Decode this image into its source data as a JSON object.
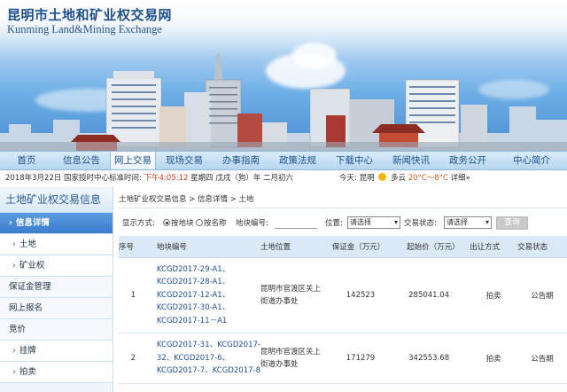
{
  "site": {
    "title_cn": "昆明市土地和矿业权交易网",
    "title_en": "Kunming Land&Mining Exchange"
  },
  "nav": [
    {
      "label": "首页"
    },
    {
      "label": "信息公告"
    },
    {
      "label": "网上交易"
    },
    {
      "label": "现场交易"
    },
    {
      "label": "办事指南"
    },
    {
      "label": "政策法规"
    },
    {
      "label": "下载中心"
    },
    {
      "label": "新闻快讯"
    },
    {
      "label": "政务公开"
    },
    {
      "label": "中心简介"
    }
  ],
  "infobar": {
    "date_prefix": "2018年3月22日 国家授时中心标准时间:",
    "time": "下午4:05:12",
    "date_suffix": "星期四 戊戌（狗）年 二月初六",
    "weather_prefix": "今天: 昆明",
    "weather_cond": "多云",
    "weather_temp": "20°C～8°C",
    "weather_detail": "详细»"
  },
  "sidebar": {
    "title": "土地矿业权交易信息",
    "items": [
      {
        "label": "信息详情"
      },
      {
        "label": "土地"
      },
      {
        "label": "矿业权"
      },
      {
        "label": "保证金管理"
      },
      {
        "label": "网上报名"
      },
      {
        "label": "竞价"
      },
      {
        "label": "挂牌"
      },
      {
        "label": "拍卖"
      }
    ]
  },
  "breadcrumb": "土地矿业权交易信息 > 信息详情 > 土地",
  "filters": {
    "display_label": "显示方式:",
    "radio_by_land": "按地块",
    "radio_by_name": "按名称",
    "land_no_label": "地块编号:",
    "location_label": "位置:",
    "location_value": "请选择",
    "status_label": "交易状态:",
    "status_value": "请选择",
    "query_button": "查询"
  },
  "table": {
    "headers": [
      "序号",
      "地块编号",
      "土地位置",
      "保证金（万元）",
      "起始价（万元）",
      "出让方式",
      "交易状态"
    ],
    "rows": [
      {
        "no": "1",
        "codes": [
          "KCGD2017-29-A1、",
          "KCGD2017-28-A1、",
          "KCGD2017-12-A1、",
          "KCGD2017-30-A1、",
          "KCGD2017-11－A1"
        ],
        "location": [
          "昆明市官渡区关上",
          "街道办事处"
        ],
        "deposit": "142523",
        "start_price": "285041.04",
        "method": "拍卖",
        "status": "公告期"
      },
      {
        "no": "2",
        "codes": [
          "KCGD2017-31、KCGD2017-",
          "32、KCGD2017-6、",
          "KCGD2017-7、KCGD2017-8"
        ],
        "location": [
          "昆明市官渡区关上",
          "街道办事处"
        ],
        "deposit": "171279",
        "start_price": "342553.68",
        "method": "拍卖",
        "status": "公告期"
      }
    ]
  }
}
